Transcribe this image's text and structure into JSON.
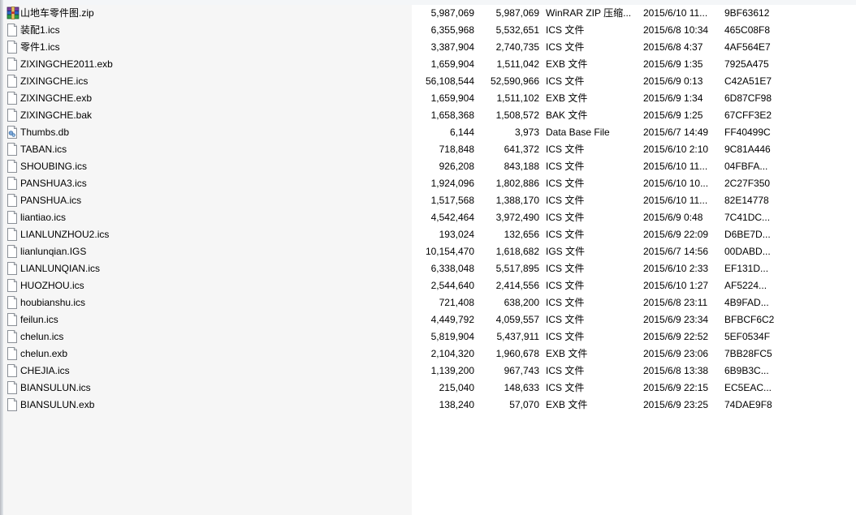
{
  "files": [
    {
      "name": "山地车零件图.zip",
      "size": "5,987,069",
      "packed": "5,987,069",
      "type": "WinRAR ZIP 压缩...",
      "modified": "2015/6/10 11...",
      "crc": "9BF63612",
      "icon": "winrar-archive-icon"
    },
    {
      "name": "装配1.ics",
      "size": "6,355,968",
      "packed": "5,532,651",
      "type": "ICS 文件",
      "modified": "2015/6/8 10:34",
      "crc": "465C08F8",
      "icon": "blank-file-icon"
    },
    {
      "name": "零件1.ics",
      "size": "3,387,904",
      "packed": "2,740,735",
      "type": "ICS 文件",
      "modified": "2015/6/8 4:37",
      "crc": "4AF564E7",
      "icon": "blank-file-icon"
    },
    {
      "name": "ZIXINGCHE2011.exb",
      "size": "1,659,904",
      "packed": "1,511,042",
      "type": "EXB 文件",
      "modified": "2015/6/9 1:35",
      "crc": "7925A475",
      "icon": "blank-file-icon"
    },
    {
      "name": "ZIXINGCHE.ics",
      "size": "56,108,544",
      "packed": "52,590,966",
      "type": "ICS 文件",
      "modified": "2015/6/9 0:13",
      "crc": "C42A51E7",
      "icon": "blank-file-icon"
    },
    {
      "name": "ZIXINGCHE.exb",
      "size": "1,659,904",
      "packed": "1,511,102",
      "type": "EXB 文件",
      "modified": "2015/6/9 1:34",
      "crc": "6D87CF98",
      "icon": "blank-file-icon"
    },
    {
      "name": "ZIXINGCHE.bak",
      "size": "1,658,368",
      "packed": "1,508,572",
      "type": "BAK 文件",
      "modified": "2015/6/9 1:25",
      "crc": "67CFF3E2",
      "icon": "blank-file-icon"
    },
    {
      "name": "Thumbs.db",
      "size": "6,144",
      "packed": "3,973",
      "type": "Data Base File",
      "modified": "2015/6/7 14:49",
      "crc": "FF40499C",
      "icon": "database-file-icon"
    },
    {
      "name": "TABAN.ics",
      "size": "718,848",
      "packed": "641,372",
      "type": "ICS 文件",
      "modified": "2015/6/10 2:10",
      "crc": "9C81A446",
      "icon": "blank-file-icon"
    },
    {
      "name": "SHOUBING.ics",
      "size": "926,208",
      "packed": "843,188",
      "type": "ICS 文件",
      "modified": "2015/6/10 11...",
      "crc": "04FBFA...",
      "icon": "blank-file-icon"
    },
    {
      "name": "PANSHUA3.ics",
      "size": "1,924,096",
      "packed": "1,802,886",
      "type": "ICS 文件",
      "modified": "2015/6/10 10...",
      "crc": "2C27F350",
      "icon": "blank-file-icon"
    },
    {
      "name": "PANSHUA.ics",
      "size": "1,517,568",
      "packed": "1,388,170",
      "type": "ICS 文件",
      "modified": "2015/6/10 11...",
      "crc": "82E14778",
      "icon": "blank-file-icon"
    },
    {
      "name": "liantiao.ics",
      "size": "4,542,464",
      "packed": "3,972,490",
      "type": "ICS 文件",
      "modified": "2015/6/9 0:48",
      "crc": "7C41DC...",
      "icon": "blank-file-icon"
    },
    {
      "name": "LIANLUNZHOU2.ics",
      "size": "193,024",
      "packed": "132,656",
      "type": "ICS 文件",
      "modified": "2015/6/9 22:09",
      "crc": "D6BE7D...",
      "icon": "blank-file-icon"
    },
    {
      "name": "lianlunqian.IGS",
      "size": "10,154,470",
      "packed": "1,618,682",
      "type": "IGS 文件",
      "modified": "2015/6/7 14:56",
      "crc": "00DABD...",
      "icon": "blank-file-icon"
    },
    {
      "name": "LIANLUNQIAN.ics",
      "size": "6,338,048",
      "packed": "5,517,895",
      "type": "ICS 文件",
      "modified": "2015/6/10 2:33",
      "crc": "EF131D...",
      "icon": "blank-file-icon"
    },
    {
      "name": "HUOZHOU.ics",
      "size": "2,544,640",
      "packed": "2,414,556",
      "type": "ICS 文件",
      "modified": "2015/6/10 1:27",
      "crc": "AF5224...",
      "icon": "blank-file-icon"
    },
    {
      "name": "houbianshu.ics",
      "size": "721,408",
      "packed": "638,200",
      "type": "ICS 文件",
      "modified": "2015/6/8 23:11",
      "crc": "4B9FAD...",
      "icon": "blank-file-icon"
    },
    {
      "name": "feilun.ics",
      "size": "4,449,792",
      "packed": "4,059,557",
      "type": "ICS 文件",
      "modified": "2015/6/9 23:34",
      "crc": "BFBCF6C2",
      "icon": "blank-file-icon"
    },
    {
      "name": "chelun.ics",
      "size": "5,819,904",
      "packed": "5,437,911",
      "type": "ICS 文件",
      "modified": "2015/6/9 22:52",
      "crc": "5EF0534F",
      "icon": "blank-file-icon"
    },
    {
      "name": "chelun.exb",
      "size": "2,104,320",
      "packed": "1,960,678",
      "type": "EXB 文件",
      "modified": "2015/6/9 23:06",
      "crc": "7BB28FC5",
      "icon": "blank-file-icon"
    },
    {
      "name": "CHEJIA.ics",
      "size": "1,139,200",
      "packed": "967,743",
      "type": "ICS 文件",
      "modified": "2015/6/8 13:38",
      "crc": "6B9B3C...",
      "icon": "blank-file-icon"
    },
    {
      "name": "BIANSULUN.ics",
      "size": "215,040",
      "packed": "148,633",
      "type": "ICS 文件",
      "modified": "2015/6/9 22:15",
      "crc": "EC5EAC...",
      "icon": "blank-file-icon"
    },
    {
      "name": "BIANSULUN.exb",
      "size": "138,240",
      "packed": "57,070",
      "type": "EXB 文件",
      "modified": "2015/6/9 23:25",
      "crc": "74DAE9F8",
      "icon": "blank-file-icon"
    }
  ]
}
